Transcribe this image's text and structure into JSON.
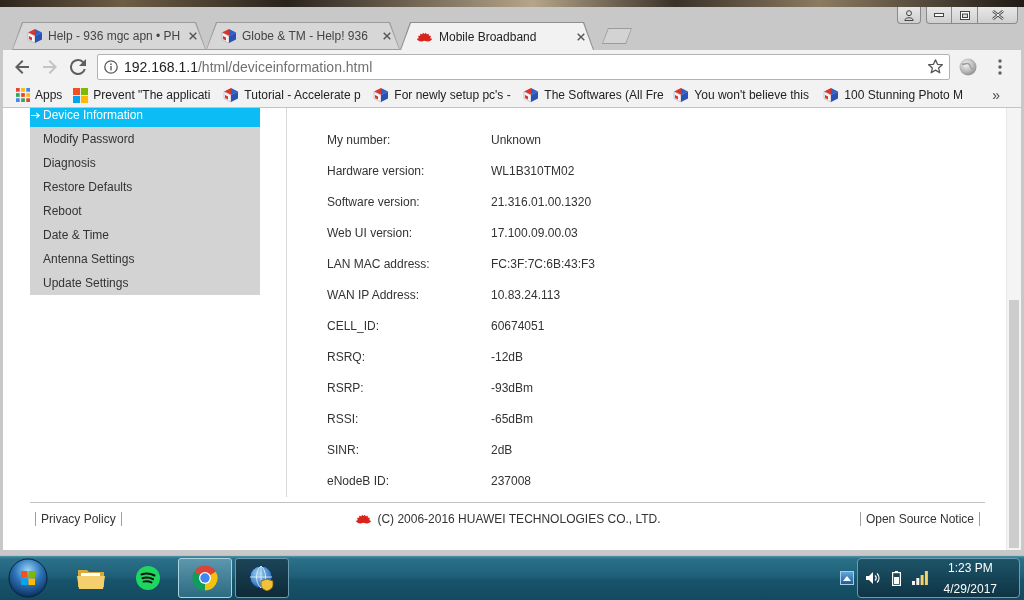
{
  "browser": {
    "tabs": [
      {
        "title": "Help - 936 mgc apn • PH",
        "kind": "cube",
        "selected": false
      },
      {
        "title": "Globe & TM - Help! 936",
        "kind": "cube",
        "selected": false
      },
      {
        "title": "Mobile Broadband",
        "kind": "petals",
        "selected": true
      }
    ],
    "nav_buttons": [
      {
        "kind": "back",
        "disabled": false
      },
      {
        "kind": "forward",
        "disabled": true
      },
      {
        "kind": "reload",
        "disabled": false
      }
    ],
    "address_bar": {
      "host": "192.168.1.1",
      "path": "/html/deviceinformation.html"
    },
    "bookmarks": [
      {
        "label": "Apps",
        "kind": "apps"
      },
      {
        "label": "Prevent \"The applicati",
        "kind": "tiles"
      },
      {
        "label": "Tutorial - Accelerate p",
        "kind": "cube"
      },
      {
        "label": "For newly setup pc's -",
        "kind": "cube"
      },
      {
        "label": "The Softwares (All Fre",
        "kind": "cube"
      },
      {
        "label": "You won't believe this",
        "kind": "cube"
      },
      {
        "label": "100 Stunning Photo M",
        "kind": "cube"
      }
    ],
    "bookmarks_overflow": "»"
  },
  "page": {
    "menu": [
      {
        "label": "Device Information",
        "selected": true
      },
      {
        "label": "Modify Password",
        "selected": false
      },
      {
        "label": "Diagnosis",
        "selected": false
      },
      {
        "label": "Restore Defaults",
        "selected": false
      },
      {
        "label": "Reboot",
        "selected": false
      },
      {
        "label": "Date & Time",
        "selected": false
      },
      {
        "label": "Antenna Settings",
        "selected": false
      },
      {
        "label": "Update Settings",
        "selected": false
      }
    ],
    "device_info": [
      {
        "label": "My number:",
        "value": "Unknown"
      },
      {
        "label": "Hardware version:",
        "value": "WL1B310TM02"
      },
      {
        "label": "Software version:",
        "value": "21.316.01.00.1320"
      },
      {
        "label": "Web UI version:",
        "value": "17.100.09.00.03"
      },
      {
        "label": "LAN MAC address:",
        "value": "FC:3F:7C:6B:43:F3"
      },
      {
        "label": "WAN IP Address:",
        "value": "10.83.24.113"
      },
      {
        "label": "CELL_ID:",
        "value": "60674051"
      },
      {
        "label": "RSRQ:",
        "value": "-12dB"
      },
      {
        "label": "RSRP:",
        "value": "-93dBm"
      },
      {
        "label": "RSSI:",
        "value": "-65dBm"
      },
      {
        "label": "SINR:",
        "value": "2dB"
      },
      {
        "label": "eNodeB ID:",
        "value": "237008"
      }
    ],
    "footer": {
      "privacy_link": "Privacy Policy",
      "copyright": "(C) 2006-2016 HUAWEI TECHNOLOGIES CO., LTD.",
      "open_source_link": "Open Source Notice"
    }
  },
  "taskbar": {
    "apps": [
      {
        "kind": "folder",
        "running": false,
        "selected": false
      },
      {
        "kind": "music",
        "running": false,
        "selected": false
      },
      {
        "kind": "browser",
        "running": true,
        "selected": true
      },
      {
        "kind": "globe",
        "running": true,
        "selected": false
      }
    ],
    "clock": {
      "time": "1:23 PM",
      "date": "4/29/2017"
    }
  }
}
